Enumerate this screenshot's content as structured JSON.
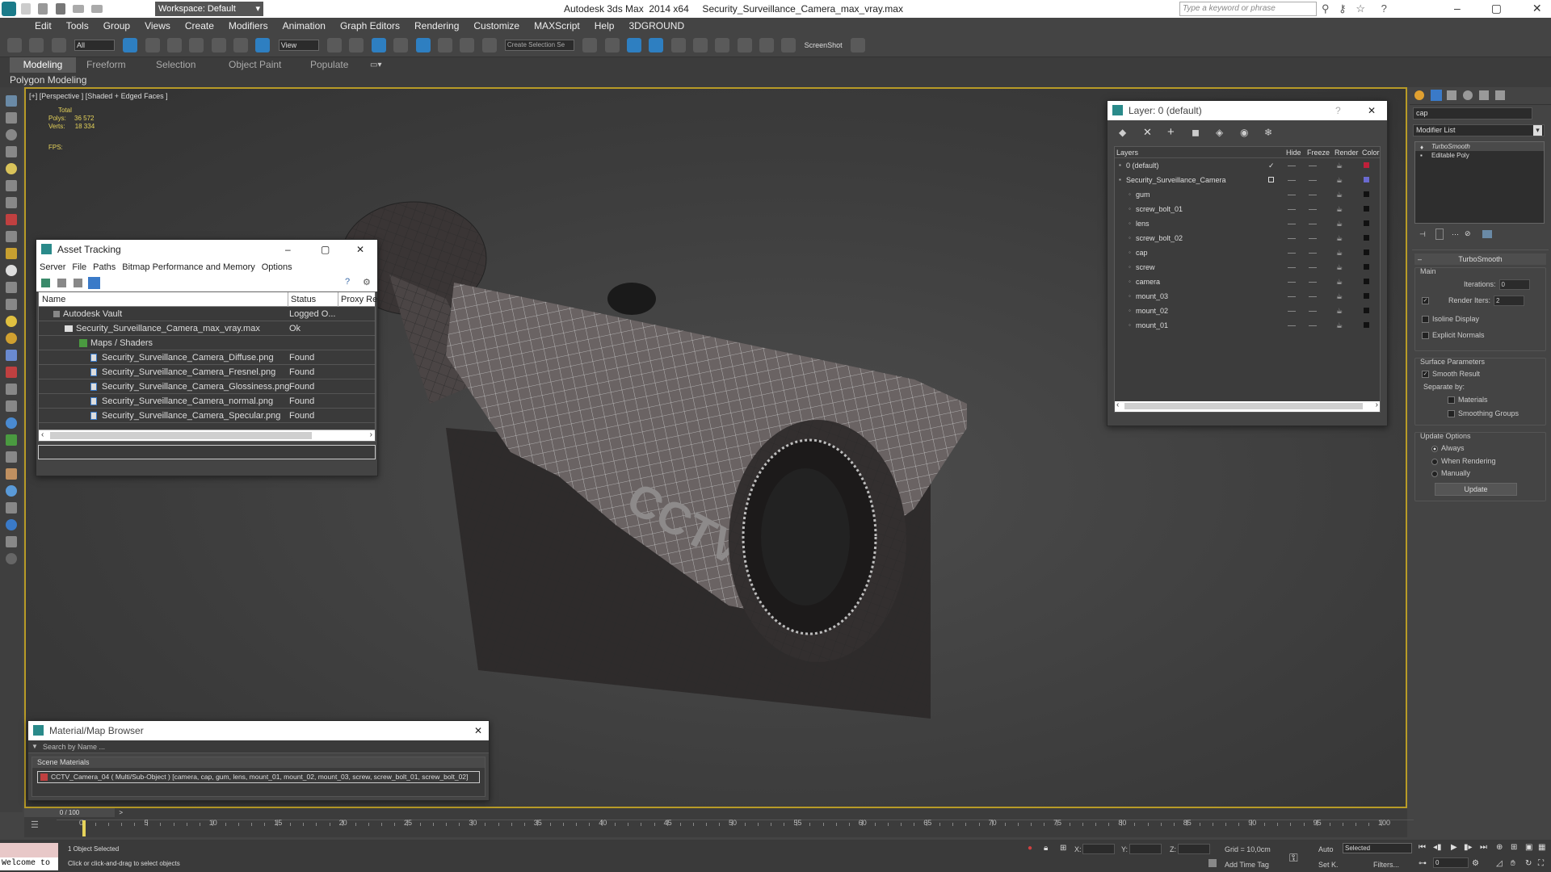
{
  "titlebar": {
    "workspace": "Workspace: Default",
    "title": "Autodesk 3ds Max  2014 x64     Security_Surveillance_Camera_max_vray.max",
    "search_placeholder": "Type a keyword or phrase"
  },
  "menu": [
    "Edit",
    "Tools",
    "Group",
    "Views",
    "Create",
    "Modifiers",
    "Animation",
    "Graph Editors",
    "Rendering",
    "Customize",
    "MAXScript",
    "Help",
    "3DGROUND"
  ],
  "toolbar": {
    "filter": "All",
    "refcoord": "View",
    "selset": "Create Selection Se",
    "screenshot": "ScreenShot"
  },
  "ribbon": {
    "tabs": [
      "Modeling",
      "Freeform",
      "Selection",
      "Object Paint",
      "Populate"
    ],
    "sub": "Polygon Modeling"
  },
  "viewport": {
    "label": "[+] [Perspective ] [Shaded + Edged Faces ]",
    "stats_total": "Total",
    "polys_label": "Polys:",
    "polys": "36 572",
    "verts_label": "Verts:",
    "verts": "18 334",
    "fps": "FPS:"
  },
  "asset_tracking": {
    "title": "Asset Tracking",
    "menu": [
      "Server",
      "File",
      "Paths",
      "Bitmap Performance and Memory",
      "Options"
    ],
    "columns": [
      "Name",
      "Status",
      "Proxy Res"
    ],
    "rows": [
      {
        "name": "Autodesk Vault",
        "status": "Logged O..."
      },
      {
        "name": "Security_Surveillance_Camera_max_vray.max",
        "status": "Ok"
      },
      {
        "name": "Maps / Shaders",
        "status": ""
      },
      {
        "name": "Security_Surveillance_Camera_Diffuse.png",
        "status": "Found"
      },
      {
        "name": "Security_Surveillance_Camera_Fresnel.png",
        "status": "Found"
      },
      {
        "name": "Security_Surveillance_Camera_Glossiness.png",
        "status": "Found"
      },
      {
        "name": "Security_Surveillance_Camera_normal.png",
        "status": "Found"
      },
      {
        "name": "Security_Surveillance_Camera_Specular.png",
        "status": "Found"
      }
    ]
  },
  "material_browser": {
    "title": "Material/Map Browser",
    "search": "Search by Name ...",
    "section": "Scene Materials",
    "item": "CCTV_Camera_04  ( Multi/Sub-Object ) [camera, cap, gum, lens, mount_01, mount_02, mount_03, screw, screw_bolt_01, screw_bolt_02]"
  },
  "layer": {
    "title": "Layer: 0 (default)",
    "help": "?",
    "columns": [
      "Layers",
      "Hide",
      "Freeze",
      "Render",
      "Color"
    ],
    "rows": [
      {
        "name": "0 (default)",
        "color": "#c0203a"
      },
      {
        "name": "Security_Surveillance_Camera",
        "color": "#6a6ad0"
      },
      {
        "name": "gum",
        "color": "#111111"
      },
      {
        "name": "screw_bolt_01",
        "color": "#111111"
      },
      {
        "name": "lens",
        "color": "#111111"
      },
      {
        "name": "screw_bolt_02",
        "color": "#111111"
      },
      {
        "name": "cap",
        "color": "#111111"
      },
      {
        "name": "screw",
        "color": "#111111"
      },
      {
        "name": "camera",
        "color": "#111111"
      },
      {
        "name": "mount_03",
        "color": "#111111"
      },
      {
        "name": "mount_02",
        "color": "#111111"
      },
      {
        "name": "mount_01",
        "color": "#111111"
      }
    ]
  },
  "cmd": {
    "name": "cap",
    "modifier_list": "Modifier List",
    "stack": [
      "TurboSmooth",
      "Editable Poly"
    ],
    "rollout": "TurboSmooth",
    "main": "Main",
    "iterations_label": "Iterations:",
    "iterations": "0",
    "render_iters_label": "Render Iters:",
    "render_iters": "2",
    "isoline": "Isoline Display",
    "explicit": "Explicit Normals",
    "surface": "Surface Parameters",
    "smooth": "Smooth Result",
    "separate": "Separate by:",
    "materials": "Materials",
    "smoothing": "Smoothing Groups",
    "update_options": "Update Options",
    "always": "Always",
    "when_rendering": "When Rendering",
    "manually": "Manually",
    "update": "Update"
  },
  "timeline": {
    "frame": "0 / 100",
    "ticks": [
      "0",
      "5",
      "10",
      "15",
      "20",
      "25",
      "30",
      "35",
      "40",
      "45",
      "50",
      "55",
      "60",
      "65",
      "70",
      "75",
      "80",
      "85",
      "90",
      "95",
      "100"
    ]
  },
  "status": {
    "welcome": "Welcome to",
    "selected": "1 Object Selected",
    "prompt": "Click or click-and-drag to select objects",
    "x": "X:",
    "y": "Y:",
    "z": "Z:",
    "grid": "Grid = 10,0cm",
    "addtime": "Add Time Tag",
    "auto": "Auto",
    "selected_dd": "Selected",
    "setk": "Set K.",
    "filters": "Filters...",
    "frame": "0"
  }
}
